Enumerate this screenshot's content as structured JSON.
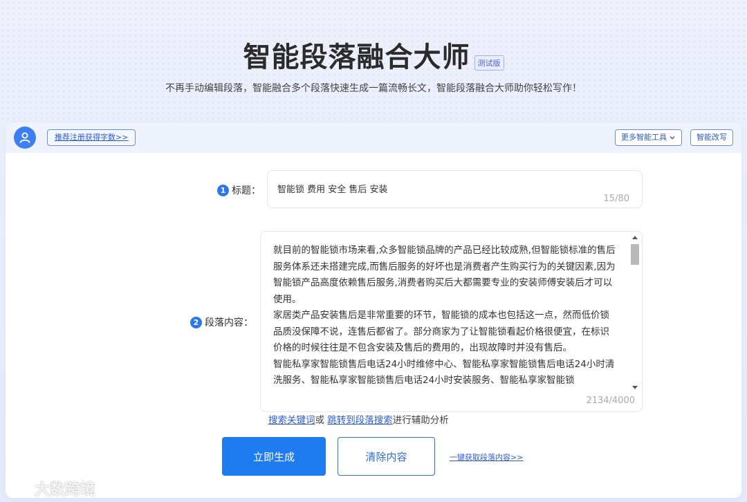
{
  "header": {
    "title": "智能段落融合大师",
    "badge": "测试版",
    "subtitle": "不再手动编辑段落，智能融合多个段落快速生成一篇流畅长文，智能段落融合大师助你轻松写作！"
  },
  "topbar": {
    "promo_link": "推荐注册获得字数>>",
    "tools_button": "更多智能工具",
    "rewrite_button": "智能改写"
  },
  "form": {
    "title_field": {
      "step": "1",
      "label": "标题：",
      "value": "智能锁 费用 安全 售后 安装",
      "count": "15/80"
    },
    "content_field": {
      "step": "2",
      "label": "段落内容：",
      "paragraphs": [
        "就目前的智能锁市场来看,众多智能锁品牌的产品已经比较成熟,但智能锁标准的售后服务体系还未搭建完成,而售后服务的好坏也是消费者产生购买行为的关键因素,因为智能锁产品高度依赖售后服务,消费者购买后大都需要专业的安装师傅安装后才可以使用。",
        "家居类产品安装售后是非常重要的环节，智能锁的成本也包括这一点，然而低价锁品质没保障不说，连售后都省了。部分商家为了让智能锁看起价格很便宜，在标识价格的时候往往是不包含安装及售后的费用的，出现故障时并没有售后。",
        "智能私享家智能锁售后电话24小时维修中心、智能私享家智能锁售后电话24小时清洗服务、智能私享家智能锁售后电话24小时安装服务、智能私享家智能锁"
      ],
      "count": "2134/4000"
    },
    "helper": {
      "link1": "搜索关键词",
      "middle": "或 ",
      "link2": "跳转到段落搜索",
      "suffix": "进行辅助分析"
    },
    "generate_button": "立即生成",
    "clear_button": "清除内容",
    "fetch_link": "一键获取段落内容>>"
  },
  "watermark": "大数跨境",
  "colors": {
    "primary": "#1f7bf0",
    "link": "#2d5bd1",
    "step_badge": "#2b78e8"
  }
}
